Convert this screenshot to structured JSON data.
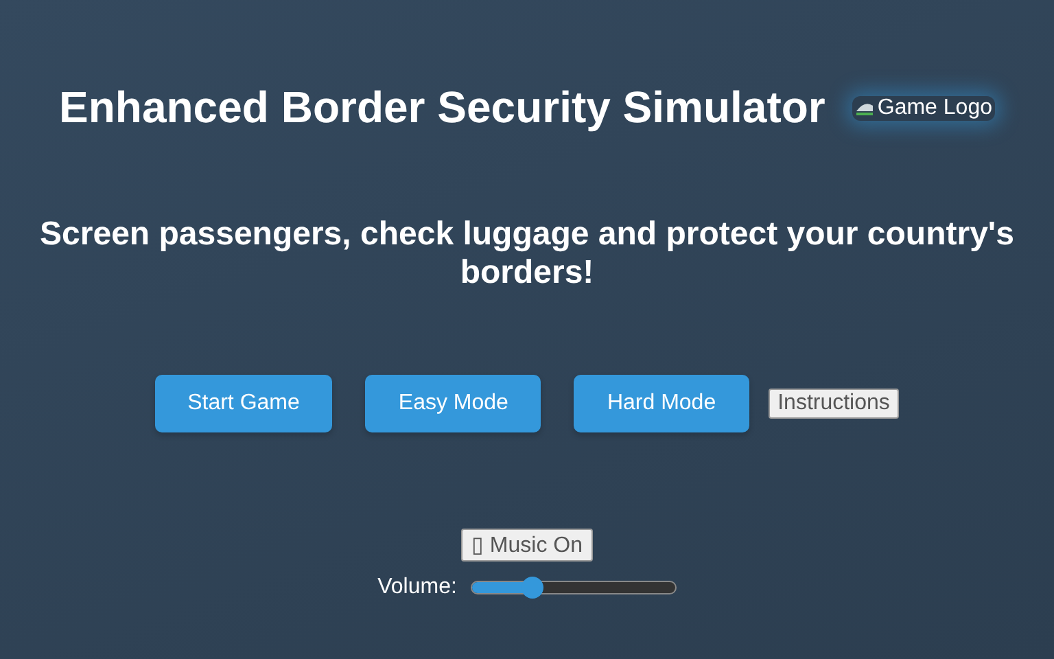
{
  "title": "Enhanced Border Security Simulator",
  "logo": {
    "alt": "Game Logo"
  },
  "subtitle": "Screen passengers, check luggage and protect your country's borders!",
  "buttons": [
    {
      "label": "Start Game",
      "kind": "primary"
    },
    {
      "label": "Easy Mode",
      "kind": "primary"
    },
    {
      "label": "Hard Mode",
      "kind": "primary"
    },
    {
      "label": "Instructions",
      "kind": "plain"
    }
  ],
  "music_button": "▯ Music On",
  "volume": {
    "label": "Volume:",
    "level": 0.3
  }
}
